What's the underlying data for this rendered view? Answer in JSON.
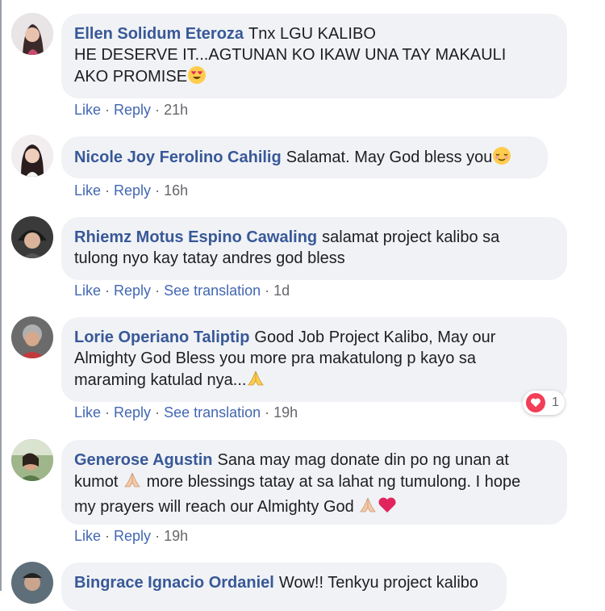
{
  "comments": [
    {
      "author": "Ellen Solidum Eteroza",
      "text_line1": "Tnx LGU KALIBO",
      "text_line2": "HE DESERVE IT...AGTUNAN KO IKAW UNA TAY MAKAULI",
      "text_line3": "AKO PROMISE",
      "emoji": "heart-eyes-emoji",
      "actions": {
        "like": "Like",
        "reply": "Reply",
        "time": "21h"
      }
    },
    {
      "author": "Nicole Joy Ferolino Cahilig",
      "text_line1": "Salamat. May God bless you",
      "emoji": "relieved-face-emoji",
      "actions": {
        "like": "Like",
        "reply": "Reply",
        "time": "16h"
      }
    },
    {
      "author": "Rhiemz Motus Espino Cawaling",
      "text_line1": "salamat project kalibo sa",
      "text_line2": "tulong nyo kay tatay andres god bless",
      "actions": {
        "like": "Like",
        "reply": "Reply",
        "translate": "See translation",
        "time": "1d"
      }
    },
    {
      "author": "Lorie Operiano Taliptip",
      "text_line1": "Good Job Project Kalibo, May our",
      "text_line2": "Almighty God Bless you more pra makatulong p kayo sa",
      "text_line3": "maraming katulad nya...",
      "emoji": "praying-hands-emoji",
      "reaction": {
        "icon": "heart-reaction-icon",
        "count": "1"
      },
      "actions": {
        "like": "Like",
        "reply": "Reply",
        "translate": "See translation",
        "time": "19h"
      }
    },
    {
      "author": "Generose Agustin",
      "text_line1": "Sana may mag donate din po ng unan at",
      "text_line2a": "kumot",
      "text_line2b": "more blessings tatay at sa lahat ng tumulong. I hope",
      "text_line3": "my prayers will reach our Almighty God",
      "emoji": "praying-hands-emoji, red-heart-emoji",
      "actions": {
        "like": "Like",
        "reply": "Reply",
        "time": "19h"
      }
    },
    {
      "author": "Bingrace Ignacio Ordaniel",
      "text_line1": "Wow!! Tenkyu project kalibo"
    }
  ],
  "colors": {
    "author": "#385898",
    "link": "#4267b2",
    "bubble": "#f0f2f5",
    "meta": "#65676b",
    "heart": "#f33e58"
  }
}
